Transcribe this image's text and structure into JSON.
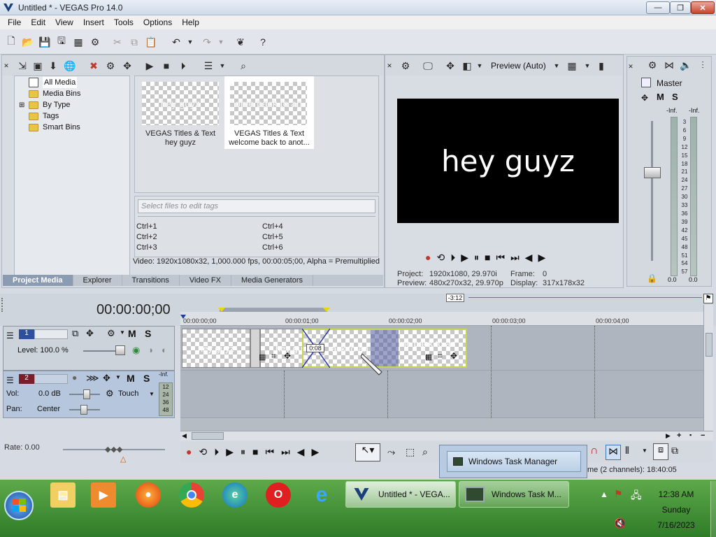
{
  "window": {
    "title": "Untitled * - VEGAS Pro 14.0"
  },
  "menu": [
    "File",
    "Edit",
    "View",
    "Insert",
    "Tools",
    "Options",
    "Help"
  ],
  "project_media": {
    "tree": [
      "All Media",
      "Media Bins",
      "By Type",
      "Tags",
      "Smart Bins"
    ],
    "media": [
      {
        "thumb_text": "hey guyz",
        "caption_line1": "VEGAS Titles & Text",
        "caption_line2": "hey guyz"
      },
      {
        "thumb_text": "ome back to an",
        "caption_line1": "VEGAS Titles & Text",
        "caption_line2": "welcome back to anot..."
      }
    ],
    "tag_placeholder": "Select files to edit tags",
    "shortcuts_left": [
      "Ctrl+1",
      "Ctrl+2",
      "Ctrl+3"
    ],
    "shortcuts_right": [
      "Ctrl+4",
      "Ctrl+5",
      "Ctrl+6"
    ],
    "info": "Video: 1920x1080x32, 1,000.000 fps, 00:00:05;00, Alpha = Premultiplied",
    "tabs": [
      "Project Media",
      "Explorer",
      "Transitions",
      "Video FX",
      "Media Generators"
    ]
  },
  "preview": {
    "mode": "Preview (Auto)",
    "screen_text": "hey guyz",
    "project_label": "Project:",
    "project_value": "1920x1080, 29.970i",
    "preview_label": "Preview:",
    "preview_value": "480x270x32, 29.970p",
    "frame_label": "Frame:",
    "frame_value": "0",
    "display_label": "Display:",
    "display_value": "317x178x32"
  },
  "master": {
    "label": "Master",
    "m": "M",
    "s": "S",
    "inf_left": "-Inf.",
    "inf_right": "-Inf.",
    "scale": [
      "3",
      "6",
      "9",
      "12",
      "15",
      "18",
      "21",
      "24",
      "27",
      "30",
      "33",
      "36",
      "39",
      "42",
      "45",
      "48",
      "51",
      "54",
      "57"
    ],
    "bottom_left": "0.0",
    "bottom_right": "0.0"
  },
  "timeline": {
    "timecode": "00:00:00;00",
    "loop_marker": "-3:12",
    "ruler": [
      "00:00:00;00",
      "00:00:01;00",
      "00:00:02;00",
      "00:00:03;00",
      "00:00:04;00"
    ],
    "track1": {
      "number": "1",
      "level": "Level: 100.0 %",
      "m": "M",
      "s": "S"
    },
    "track2": {
      "number": "2",
      "vol_label": "Vol:",
      "vol_value": "0.0 dB",
      "pan_label": "Pan:",
      "pan_value": "Center",
      "automation": "Touch",
      "m": "M",
      "s": "S",
      "inf": "-Inf.",
      "meter_scale": [
        "12",
        "24",
        "36",
        "48"
      ]
    },
    "clip1": "hey guyz",
    "clip2": "hey gu",
    "transition": "0:08",
    "clip3": "ack to an",
    "clip4": "me back to an",
    "rate": "Rate: 0.00",
    "status": "me (2 channels): 18:40:05"
  },
  "taskbar": {
    "tasks": [
      {
        "label": "Untitled * - VEGA..."
      },
      {
        "label": "Windows Task M..."
      }
    ],
    "popup": "Windows Task Manager",
    "time": "12:38 AM",
    "day": "Sunday",
    "date": "7/16/2023"
  }
}
